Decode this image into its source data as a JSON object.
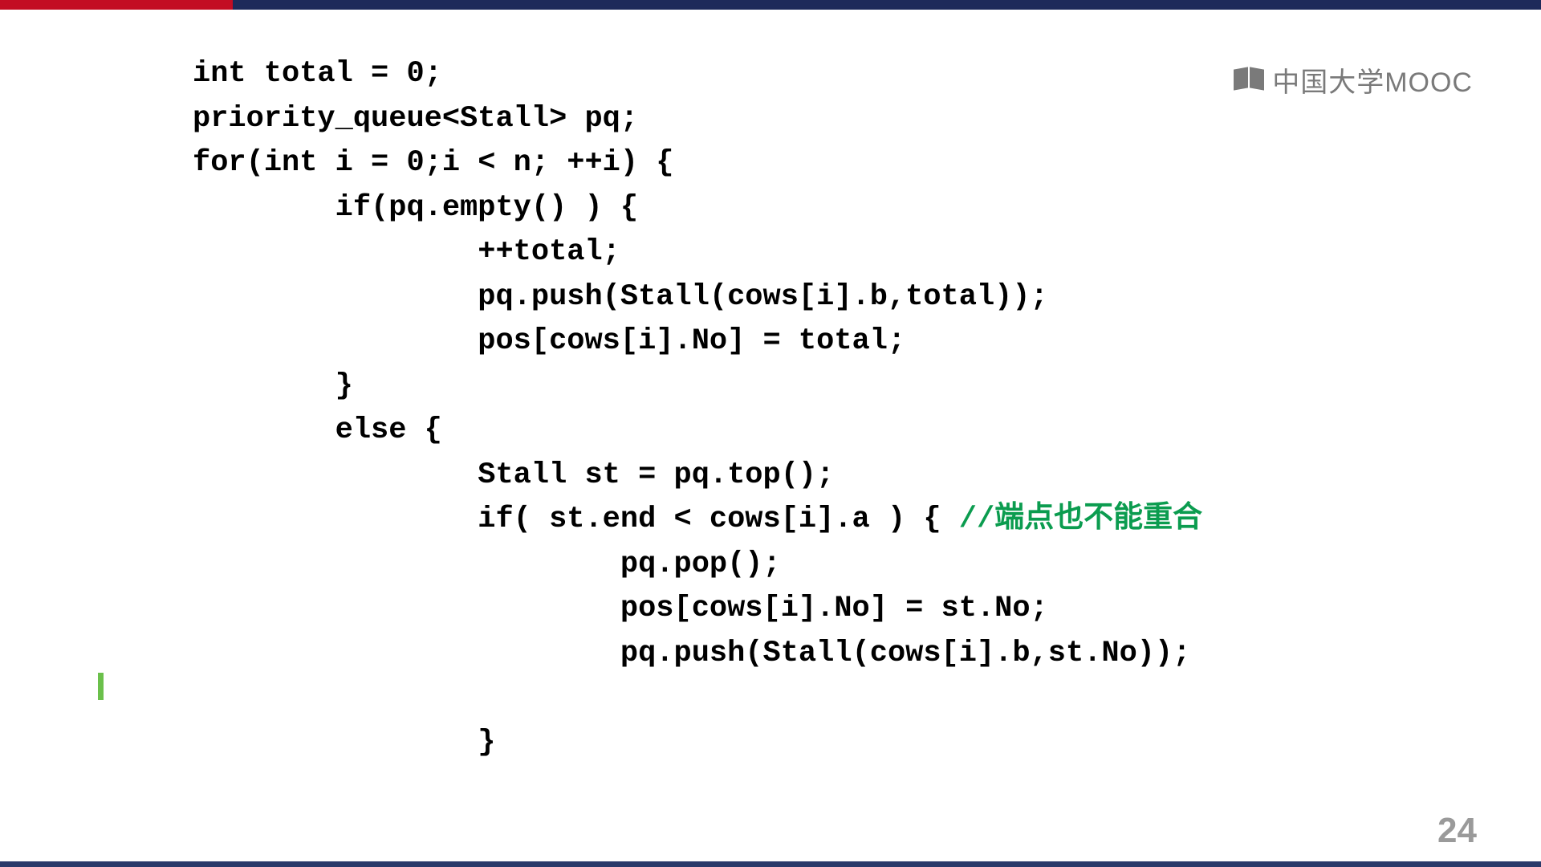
{
  "topBar": {
    "redColor": "#c30d23",
    "navyColor": "#1e2a5a"
  },
  "logo": {
    "text": "中国大学MOOC"
  },
  "code": {
    "line1": "int total = 0;",
    "line2": "priority_queue<Stall> pq;",
    "line3": "for(int i = 0;i < n; ++i) {",
    "line4": "        if(pq.empty() ) {",
    "line5": "                ++total;",
    "line6": "                pq.push(Stall(cows[i].b,total));",
    "line7": "                pos[cows[i].No] = total;",
    "line8": "        }",
    "line9": "        else {",
    "line10": "                Stall st = pq.top();",
    "line11a": "                if( st.end < cows[i].a ) { ",
    "line11b": "//端点也不能重合",
    "line12": "                        pq.pop();",
    "line13": "                        pos[cows[i].No] = st.No;",
    "line14": "                        pq.push(Stall(cows[i].b,st.No));",
    "line15": "",
    "line16": "                }"
  },
  "pageNumber": "24"
}
